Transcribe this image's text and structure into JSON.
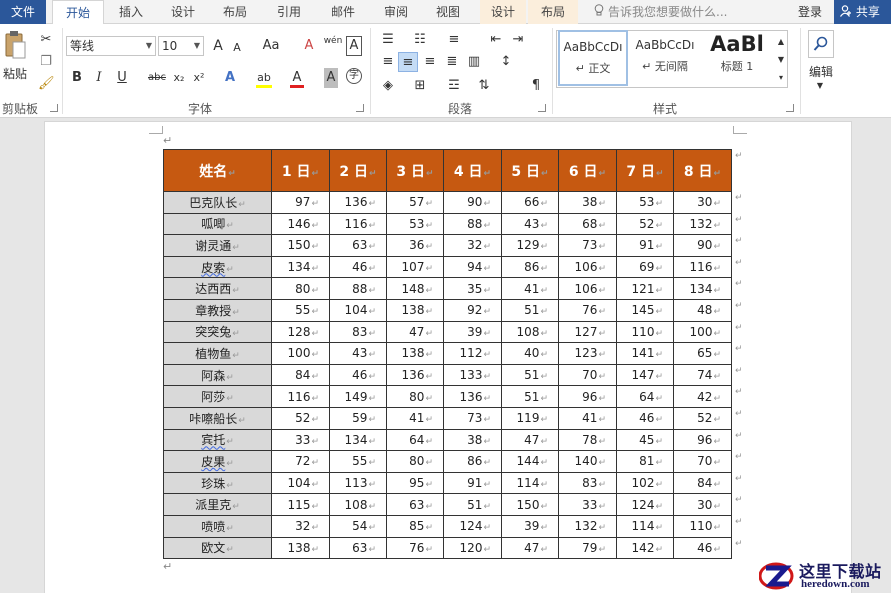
{
  "tabs": {
    "file": "文件",
    "home": "开始",
    "insert": "插入",
    "design": "设计",
    "layout": "布局",
    "references": "引用",
    "mailings": "邮件",
    "review": "审阅",
    "view": "视图",
    "table_design": "设计",
    "table_layout": "布局"
  },
  "tell_me": "告诉我您想要做什么...",
  "login": "登录",
  "share": "共享",
  "ribbon": {
    "clipboard": {
      "paste": "粘贴",
      "label": "剪贴板"
    },
    "font": {
      "family": "等线",
      "size": "10",
      "label": "字体",
      "grow": "A",
      "shrink": "A",
      "case": "Aa",
      "clear": "A",
      "phonetic": "wén",
      "border_char": "A",
      "bold": "B",
      "italic": "I",
      "underline": "U",
      "strike": "abc",
      "subscript": "x₂",
      "superscript": "x²",
      "text_effect": "A",
      "highlight": "ab",
      "font_color": "A",
      "char_shading": "A",
      "enclose": "字"
    },
    "paragraph": {
      "label": "段落"
    },
    "styles": {
      "label": "样式",
      "items": [
        {
          "sample": "AaBbCcDı",
          "name": "↵ 正文"
        },
        {
          "sample": "AaBbCcDı",
          "name": "↵ 无间隔"
        },
        {
          "sample": "AaBl",
          "name": "标题 1"
        }
      ]
    },
    "editing": {
      "label": "编辑"
    }
  },
  "table": {
    "header": [
      "姓名",
      "1 日",
      "2 日",
      "3 日",
      "4 日",
      "5 日",
      "6 日",
      "7 日",
      "8 日"
    ],
    "rows": [
      [
        "巴克队长",
        "97",
        "136",
        "57",
        "90",
        "66",
        "38",
        "53",
        "30"
      ],
      [
        "呱唧",
        "146",
        "116",
        "53",
        "88",
        "43",
        "68",
        "52",
        "132"
      ],
      [
        "谢灵通",
        "150",
        "63",
        "36",
        "32",
        "129",
        "73",
        "91",
        "90"
      ],
      [
        "皮索",
        "134",
        "46",
        "107",
        "94",
        "86",
        "106",
        "69",
        "116"
      ],
      [
        "达西西",
        "80",
        "88",
        "148",
        "35",
        "41",
        "106",
        "121",
        "134"
      ],
      [
        "章教授",
        "55",
        "104",
        "138",
        "92",
        "51",
        "76",
        "145",
        "48"
      ],
      [
        "突突兔",
        "128",
        "83",
        "47",
        "39",
        "108",
        "127",
        "110",
        "100"
      ],
      [
        "植物鱼",
        "100",
        "43",
        "138",
        "112",
        "40",
        "123",
        "141",
        "65"
      ],
      [
        "阿森",
        "84",
        "46",
        "136",
        "133",
        "51",
        "70",
        "147",
        "74"
      ],
      [
        "阿莎",
        "116",
        "149",
        "80",
        "136",
        "51",
        "96",
        "64",
        "42"
      ],
      [
        "咔嚓船长",
        "52",
        "59",
        "41",
        "73",
        "119",
        "41",
        "46",
        "52"
      ],
      [
        "宾托",
        "33",
        "134",
        "64",
        "38",
        "47",
        "78",
        "45",
        "96"
      ],
      [
        "皮果",
        "72",
        "55",
        "80",
        "86",
        "144",
        "140",
        "81",
        "70"
      ],
      [
        "珍珠",
        "104",
        "113",
        "95",
        "91",
        "114",
        "83",
        "102",
        "84"
      ],
      [
        "派里克",
        "115",
        "108",
        "63",
        "51",
        "150",
        "33",
        "124",
        "30"
      ],
      [
        "喷喷",
        "32",
        "54",
        "85",
        "124",
        "39",
        "132",
        "114",
        "110"
      ],
      [
        "欧文",
        "138",
        "63",
        "76",
        "120",
        "47",
        "79",
        "142",
        "46"
      ]
    ],
    "squiggle_names": [
      "皮索",
      "宾托",
      "皮果"
    ]
  },
  "watermark": {
    "title": "这里下载站",
    "domain": "heredown.com"
  },
  "colors": {
    "accent": "#2b579a",
    "table_header": "#c65911",
    "name_cell": "#d9d9d9"
  }
}
